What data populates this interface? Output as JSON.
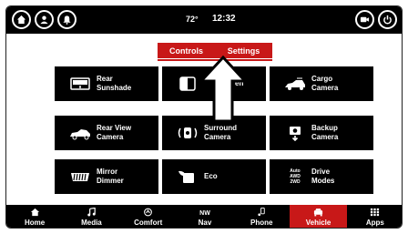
{
  "status_bar": {
    "temperature": "72°",
    "time": "12:32"
  },
  "tabs": [
    {
      "label": "Controls",
      "active": true
    },
    {
      "label": "Settings",
      "active": false
    }
  ],
  "tiles": [
    {
      "line1": "Rear",
      "line2": "Sunshade",
      "icon": "sunshade-icon"
    },
    {
      "line1": "",
      "line2": "en",
      "icon": "screen-icon"
    },
    {
      "line1": "Cargo",
      "line2": "Camera",
      "icon": "cargo-camera-icon"
    },
    {
      "line1": "Rear View",
      "line2": "Camera",
      "icon": "rear-view-camera-icon"
    },
    {
      "line1": "Surround",
      "line2": "Camera",
      "icon": "surround-camera-icon"
    },
    {
      "line1": "Backup",
      "line2": "Camera",
      "icon": "backup-camera-icon"
    },
    {
      "line1": "Mirror",
      "line2": "Dimmer",
      "icon": "mirror-dimmer-icon"
    },
    {
      "line1": "Eco",
      "line2": "",
      "icon": "eco-icon"
    },
    {
      "line1": "Drive",
      "line2": "Modes",
      "icon": "drive-modes-icon",
      "icon_text": [
        "Auto",
        "AWD",
        "2WD"
      ]
    }
  ],
  "nav": [
    {
      "label": "Home",
      "icon": "home-icon",
      "active": false
    },
    {
      "label": "Media",
      "icon": "music-note-icon",
      "active": false
    },
    {
      "label": "Comfort",
      "icon": "comfort-icon",
      "active": false
    },
    {
      "label": "Nav",
      "icon": "compass-icon",
      "compass": "NW",
      "active": false
    },
    {
      "label": "Phone",
      "icon": "phone-icon",
      "active": false
    },
    {
      "label": "Vehicle",
      "icon": "car-icon",
      "active": true
    },
    {
      "label": "Apps",
      "icon": "apps-grid-icon",
      "active": false
    }
  ],
  "colors": {
    "accent": "#c81818",
    "bar": "#000000",
    "tile": "#000000"
  }
}
